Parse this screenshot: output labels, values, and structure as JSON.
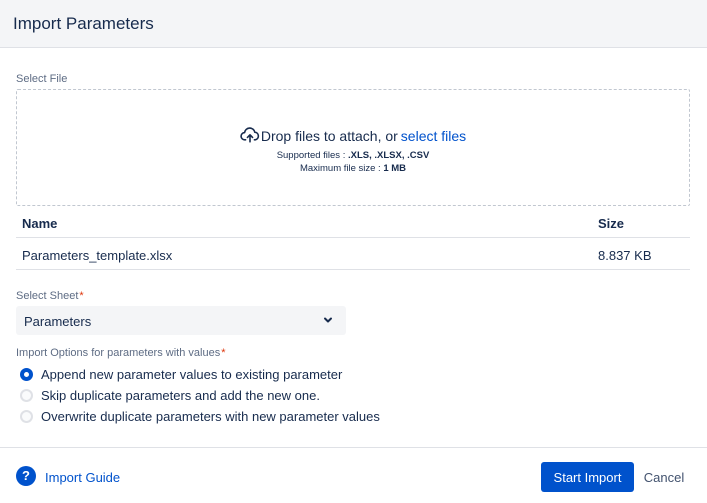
{
  "dialog": {
    "title": "Import Parameters"
  },
  "file_section": {
    "label": "Select File",
    "drop_text": "Drop files to attach, or",
    "select_link": "select files",
    "supported_prefix": "Supported files : ",
    "supported_types": ".XLS, .XLSX, .CSV",
    "max_prefix": "Maximum file size : ",
    "max_size": "1 MB",
    "icon": "cloud-upload-icon"
  },
  "file_table": {
    "columns": [
      "Name",
      "Size"
    ],
    "rows": [
      {
        "name": "Parameters_template.xlsx",
        "size": "8.837 KB"
      }
    ]
  },
  "sheet": {
    "label": "Select Sheet",
    "required_mark": "*",
    "selected": "Parameters",
    "icon": "chevron-down-icon"
  },
  "import_options": {
    "label": "Import Options for parameters with values",
    "required_mark": "*",
    "options": [
      {
        "label": "Append new parameter values to existing parameter",
        "selected": true
      },
      {
        "label": "Skip duplicate parameters and add the new one.",
        "selected": false
      },
      {
        "label": "Overwrite duplicate parameters with new parameter values",
        "selected": false
      }
    ]
  },
  "footer": {
    "guide_icon_glyph": "?",
    "guide_label": "Import Guide",
    "start_label": "Start Import",
    "cancel_label": "Cancel"
  },
  "colors": {
    "primary": "#0052cc",
    "required": "#de350b",
    "header_bg": "#f4f5f7"
  }
}
